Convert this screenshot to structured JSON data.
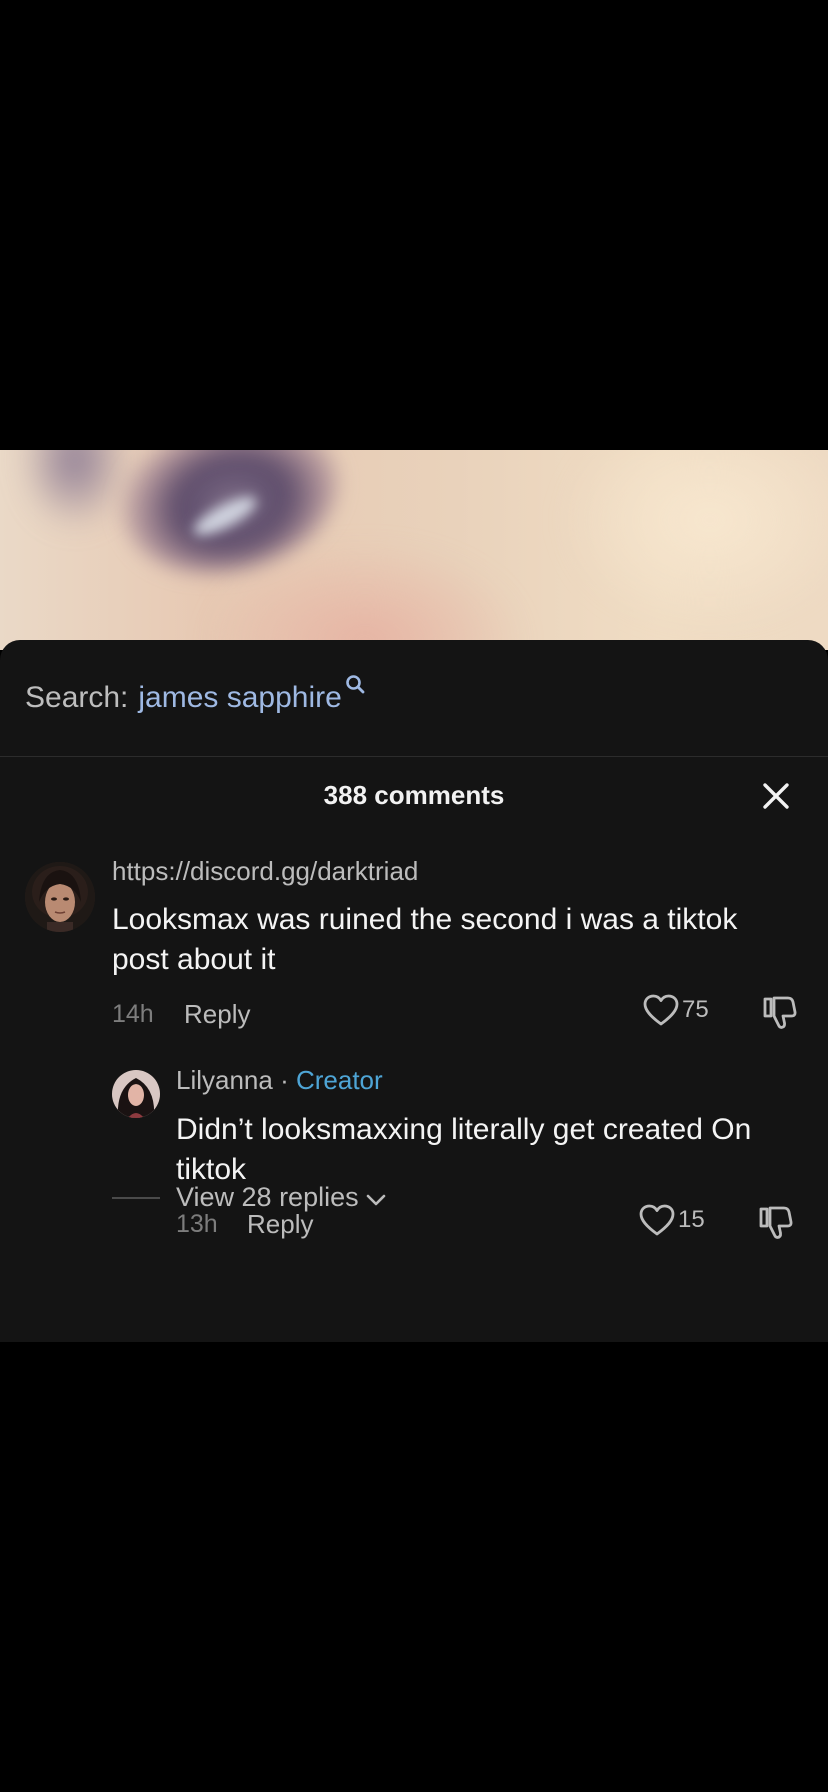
{
  "search": {
    "label": "Search:",
    "term": "james sapphire"
  },
  "comments": {
    "count_label": "388 comments"
  },
  "comment": {
    "username": "https://discord.gg/darktriad",
    "text": "Looksmax was ruined the second i was a tiktok post about it",
    "time": "14h",
    "reply_label": "Reply",
    "likes": "75"
  },
  "reply": {
    "username": "Lilyanna",
    "separator": " · ",
    "badge": "Creator",
    "text": "Didn’t looksmaxxing literally get created On tiktok",
    "time": "13h",
    "reply_label": "Reply",
    "likes": "15"
  },
  "view_replies": {
    "label": "View 28 replies"
  },
  "colors": {
    "sheet_bg": "#141414",
    "search_term": "#9fb9e3",
    "creator_badge": "#4ea5d6"
  },
  "icons": [
    "search-icon",
    "close-icon",
    "heart-icon",
    "dislike-icon",
    "chevron-down-icon"
  ]
}
